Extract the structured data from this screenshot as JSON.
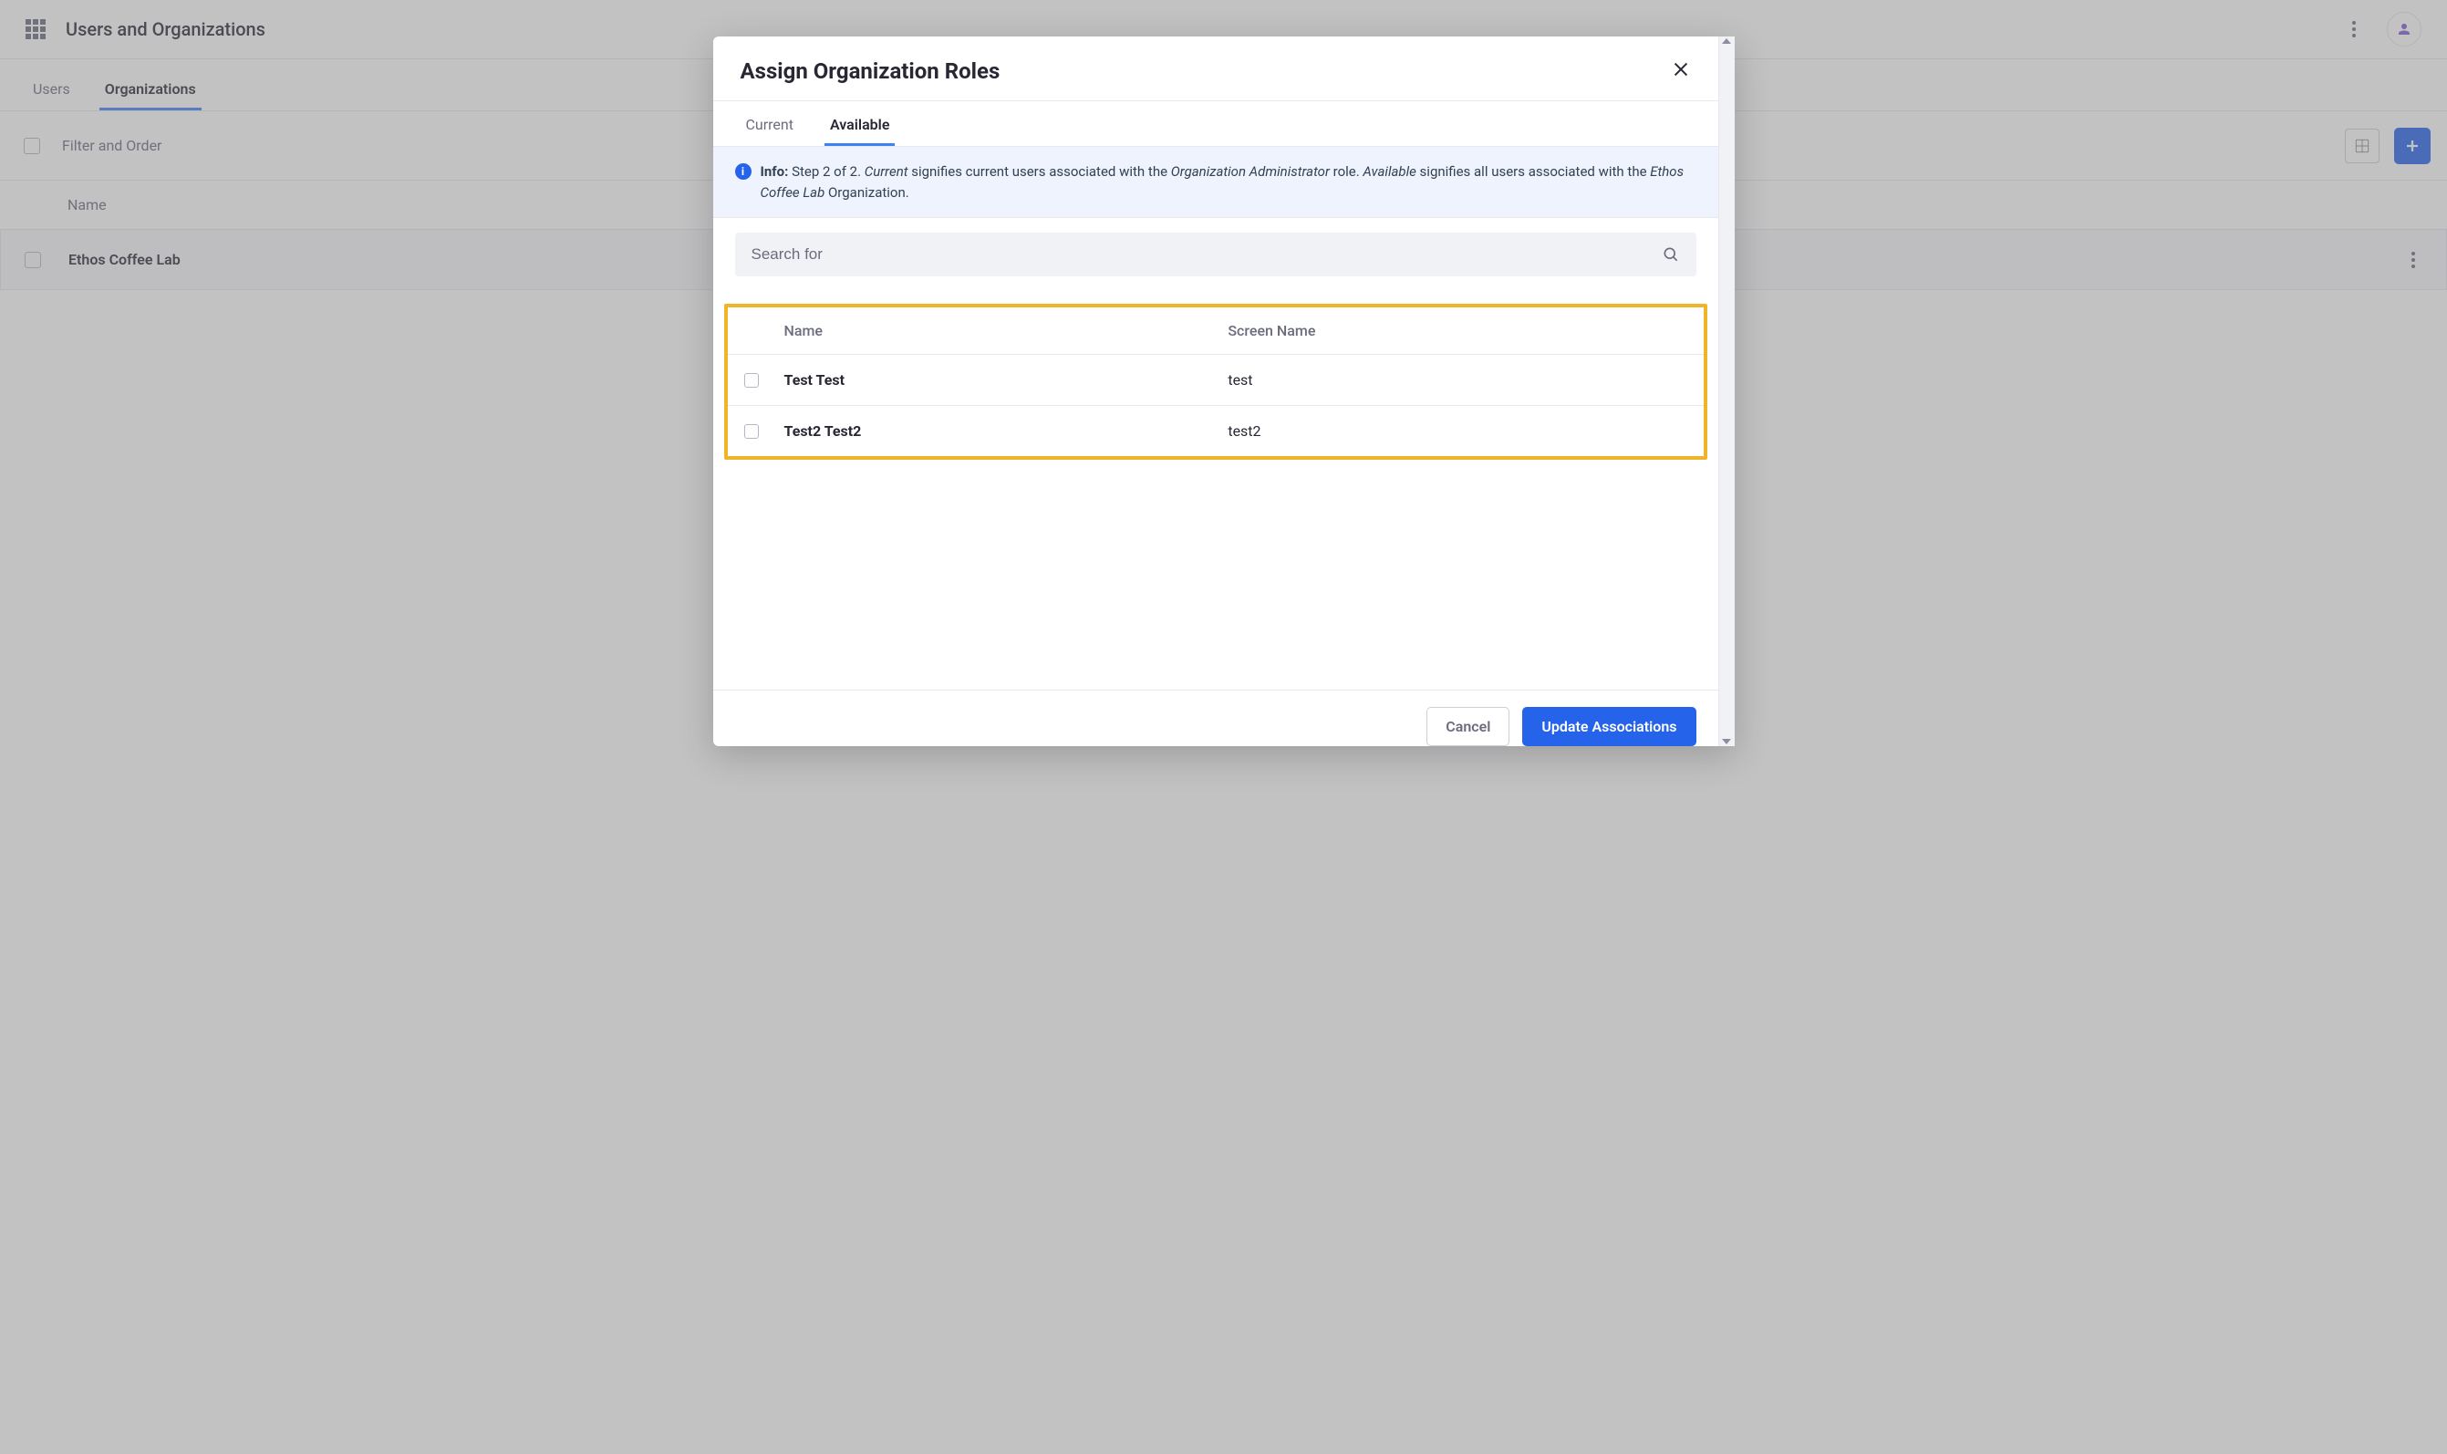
{
  "topbar": {
    "title": "Users and Organizations"
  },
  "subtabs": {
    "items": [
      {
        "label": "Users",
        "active": false
      },
      {
        "label": "Organizations",
        "active": true
      }
    ]
  },
  "toolbar": {
    "filter_label": "Filter and Order"
  },
  "bg_table": {
    "header_name": "Name",
    "row_name": "Ethos Coffee Lab"
  },
  "modal": {
    "title": "Assign Organization Roles",
    "tabs": [
      {
        "label": "Current",
        "active": false
      },
      {
        "label": "Available",
        "active": true
      }
    ],
    "info": {
      "lead": "Info:",
      "pre": "Step 2 of 2. ",
      "i1": "Current",
      "mid1": " signifies current users associated with the ",
      "i2": "Organization Administrator",
      "mid2": " role. ",
      "i3": "Available",
      "mid3": " signifies all users associated with the ",
      "i4": "Ethos Coffee Lab",
      "post": " Organization."
    },
    "search_placeholder": "Search for",
    "table": {
      "col_name": "Name",
      "col_screen": "Screen Name",
      "rows": [
        {
          "name": "Test Test",
          "screen": "test"
        },
        {
          "name": "Test2 Test2",
          "screen": "test2"
        }
      ]
    },
    "footer": {
      "cancel": "Cancel",
      "update": "Update Associations"
    }
  }
}
